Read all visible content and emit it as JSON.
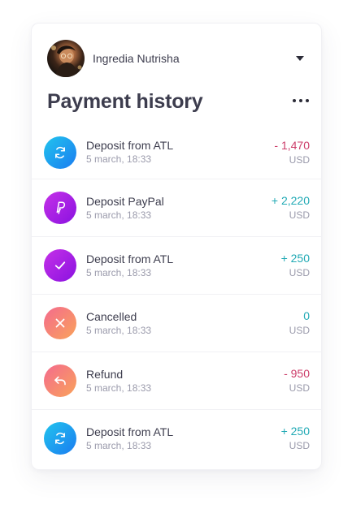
{
  "profile": {
    "name": "Ingredia Nutrisha"
  },
  "header": {
    "title": "Payment history"
  },
  "colors": {
    "negative": "#cc3d6a",
    "positive": "#22aab5",
    "blue_gradient": [
      "#22c4ee",
      "#1a7cf0"
    ],
    "purple_gradient": [
      "#c531e8",
      "#8a12e0"
    ],
    "orange_gradient": [
      "#f46a8e",
      "#f9a35a"
    ]
  },
  "transactions": [
    {
      "label": "Deposit from ATL",
      "date": "5 march, 18:33",
      "amount": "- 1,470",
      "currency": "USD",
      "icon": "refresh-icon",
      "color": "#cc3d6a"
    },
    {
      "label": "Deposit PayPal",
      "date": "5 march, 18:33",
      "amount": "+ 2,220",
      "currency": "USD",
      "icon": "paypal-icon",
      "color": "#22aab5"
    },
    {
      "label": "Deposit from ATL",
      "date": "5 march, 18:33",
      "amount": "+ 250",
      "currency": "USD",
      "icon": "check-icon",
      "color": "#22aab5"
    },
    {
      "label": "Cancelled",
      "date": "5 march, 18:33",
      "amount": "0",
      "currency": "USD",
      "icon": "close-icon",
      "color": "#22aab5"
    },
    {
      "label": "Refund",
      "date": "5 march, 18:33",
      "amount": "- 950",
      "currency": "USD",
      "icon": "reply-icon",
      "color": "#cc3d6a"
    },
    {
      "label": "Deposit from ATL",
      "date": "5 march, 18:33",
      "amount": "+ 250",
      "currency": "USD",
      "icon": "refresh-icon",
      "color": "#22aab5"
    }
  ]
}
